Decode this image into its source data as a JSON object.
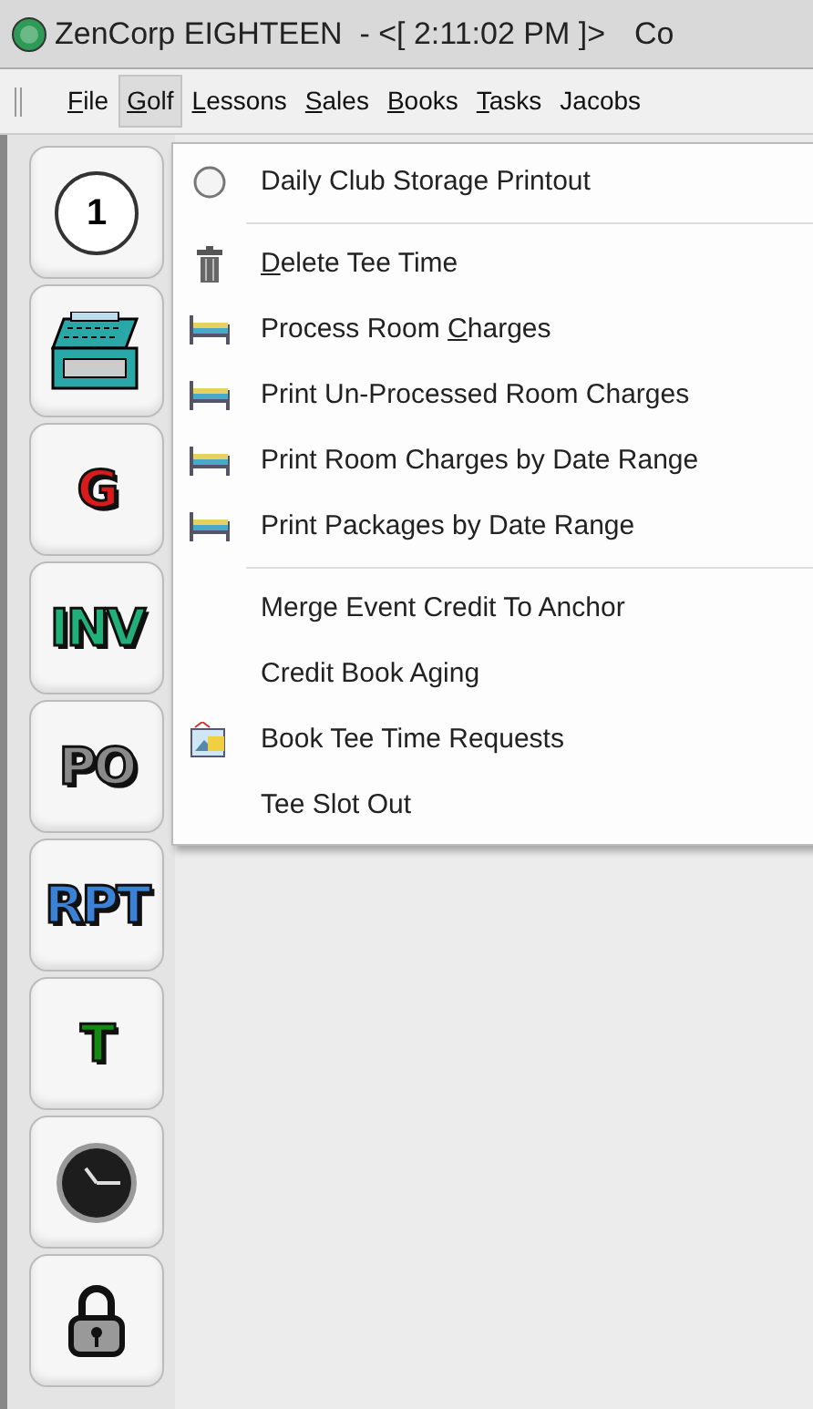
{
  "window": {
    "title": "ZenCorp EIGHTEEN  - <[ 2:11:02 PM ]>",
    "title_cut": "Co"
  },
  "menu_bar": [
    {
      "parts": [
        {
          "text": "F",
          "underlined": true
        },
        {
          "text": "ile",
          "underlined": false
        }
      ],
      "selected": false
    },
    {
      "parts": [
        {
          "text": "G",
          "underlined": true
        },
        {
          "text": "olf",
          "underlined": false
        }
      ],
      "selected": true
    },
    {
      "parts": [
        {
          "text": "L",
          "underlined": true
        },
        {
          "text": "essons",
          "underlined": false
        }
      ],
      "selected": false
    },
    {
      "parts": [
        {
          "text": "S",
          "underlined": true
        },
        {
          "text": "ales",
          "underlined": false
        }
      ],
      "selected": false
    },
    {
      "parts": [
        {
          "text": "B",
          "underlined": true
        },
        {
          "text": "ooks",
          "underlined": false
        }
      ],
      "selected": false
    },
    {
      "parts": [
        {
          "text": "T",
          "underlined": true
        },
        {
          "text": "asks",
          "underlined": false
        }
      ],
      "selected": false
    },
    {
      "parts": [
        {
          "text": "Jacobs",
          "underlined": false
        }
      ],
      "selected": false
    }
  ],
  "toolbar": [
    {
      "kind": "ball",
      "label": "1"
    },
    {
      "kind": "register"
    },
    {
      "kind": "letters",
      "label": "G",
      "color": "#d81c1c"
    },
    {
      "kind": "letters",
      "label": "INV",
      "color": "#22b07a"
    },
    {
      "kind": "letters",
      "label": "PO",
      "color": "#8a8a8a"
    },
    {
      "kind": "letters",
      "label": "RPT",
      "color": "#3b82d6"
    },
    {
      "kind": "letters",
      "label": "T",
      "color": "#138a13"
    },
    {
      "kind": "clock"
    },
    {
      "kind": "lock"
    }
  ],
  "dropdown": [
    {
      "kind": "ball",
      "parts": [
        {
          "text": "Daily Club Storage Printout",
          "underlined": false
        }
      ]
    },
    {
      "kind": "separator"
    },
    {
      "kind": "trash",
      "parts": [
        {
          "text": "D",
          "underlined": true
        },
        {
          "text": "elete Tee Time",
          "underlined": false
        }
      ]
    },
    {
      "kind": "bed",
      "parts": [
        {
          "text": "Process Room ",
          "underlined": false
        },
        {
          "text": "C",
          "underlined": true
        },
        {
          "text": "harges",
          "underlined": false
        }
      ]
    },
    {
      "kind": "bed",
      "parts": [
        {
          "text": "Print Un-Processed Room Charges",
          "underlined": false
        }
      ]
    },
    {
      "kind": "bed",
      "parts": [
        {
          "text": "Print Room Charges by Date Range",
          "underlined": false
        }
      ]
    },
    {
      "kind": "bed",
      "parts": [
        {
          "text": "Print Packages by Date Range",
          "underlined": false
        }
      ]
    },
    {
      "kind": "separator"
    },
    {
      "kind": "plain",
      "parts": [
        {
          "text": "Merge Event Credit To Anchor",
          "underlined": false
        }
      ]
    },
    {
      "kind": "plain",
      "parts": [
        {
          "text": "Credit Book Aging",
          "underlined": false
        }
      ]
    },
    {
      "kind": "book",
      "parts": [
        {
          "text": "Book Tee Time Requests",
          "underlined": false
        }
      ]
    },
    {
      "kind": "plain",
      "parts": [
        {
          "text": "Tee Slot Out",
          "underlined": false
        }
      ]
    }
  ]
}
